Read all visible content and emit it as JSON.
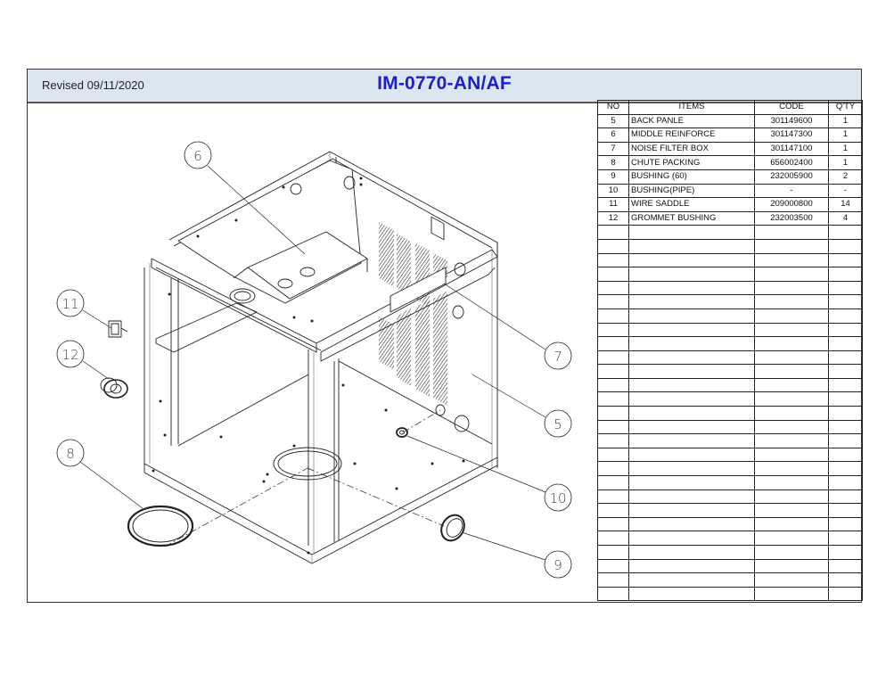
{
  "header": {
    "revised": "Revised 09/11/2020",
    "title": "IM-0770-AN/AF",
    "background_color": "#dce6f1",
    "title_color": "#1f1fc8"
  },
  "parts_table": {
    "columns": [
      "NO",
      "ITEMS",
      "CODE",
      "Q'TY"
    ],
    "rows": [
      {
        "no": "5",
        "item": "BACK PANLE",
        "code": "301149600",
        "qty": "1"
      },
      {
        "no": "6",
        "item": "MIDDLE REINFORCE",
        "code": "301147300",
        "qty": "1"
      },
      {
        "no": "7",
        "item": "NOISE FILTER BOX",
        "code": "301147100",
        "qty": "1"
      },
      {
        "no": "8",
        "item": "CHUTE PACKING",
        "code": "656002400",
        "qty": "1"
      },
      {
        "no": "9",
        "item": "BUSHING (60)",
        "code": "232005900",
        "qty": "2"
      },
      {
        "no": "10",
        "item": "BUSHING(PIPE)",
        "code": "-",
        "qty": "-"
      },
      {
        "no": "11",
        "item": "WIRE SADDLE",
        "code": "209000800",
        "qty": "14"
      },
      {
        "no": "12",
        "item": "GROMMET BUSHING",
        "code": "232003500",
        "qty": "4"
      }
    ],
    "empty_rows": 27
  },
  "drawing": {
    "description": "Exploded isometric view of ice machine cabinet frame",
    "callouts": [
      {
        "label": "6",
        "icon": "callout-balloon"
      },
      {
        "label": "11",
        "icon": "callout-balloon"
      },
      {
        "label": "12",
        "icon": "callout-balloon"
      },
      {
        "label": "8",
        "icon": "callout-balloon"
      },
      {
        "label": "7",
        "icon": "callout-balloon"
      },
      {
        "label": "5",
        "icon": "callout-balloon"
      },
      {
        "label": "10",
        "icon": "callout-balloon"
      },
      {
        "label": "9",
        "icon": "callout-balloon"
      }
    ]
  }
}
